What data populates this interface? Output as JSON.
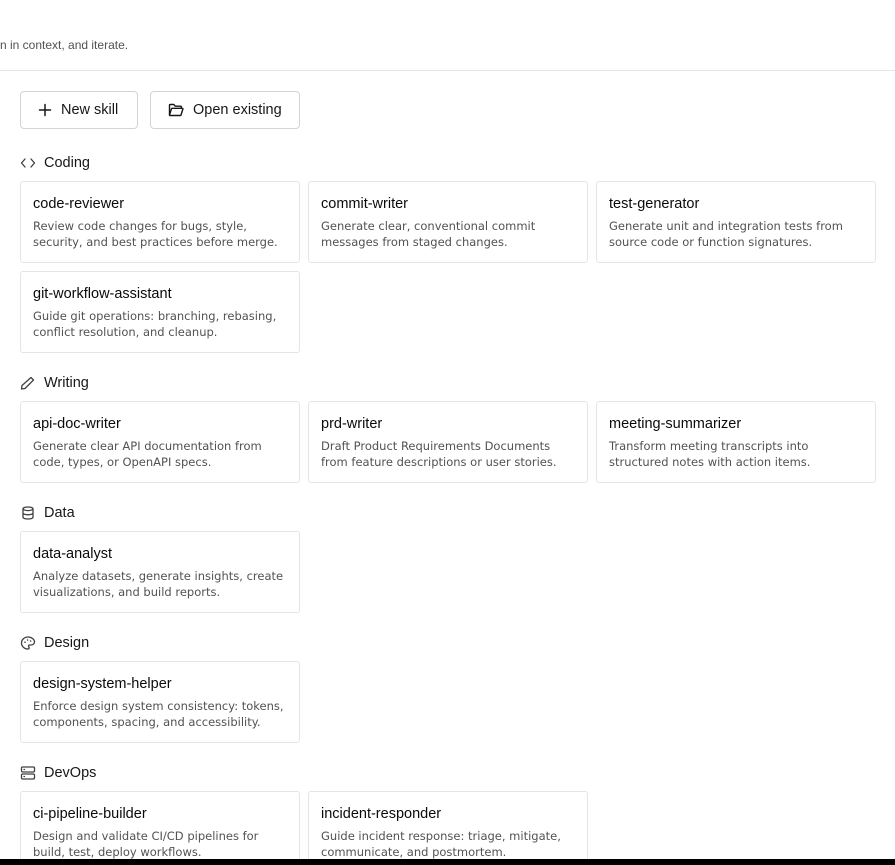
{
  "header": {
    "subtitle_fragment": "n in context, and iterate."
  },
  "actions": {
    "new_skill": "New skill",
    "open_existing": "Open existing"
  },
  "sections": {
    "coding": {
      "label": "Coding",
      "icon": "code-icon",
      "cards": [
        {
          "title": "code-reviewer",
          "desc": "Review code changes for bugs, style, security, and best practices before merge."
        },
        {
          "title": "commit-writer",
          "desc": "Generate clear, conventional commit messages from staged changes."
        },
        {
          "title": "test-generator",
          "desc": "Generate unit and integration tests from source code or function signatures."
        },
        {
          "title": "git-workflow-assistant",
          "desc": "Guide git operations: branching, rebasing, conflict resolution, and cleanup."
        }
      ]
    },
    "writing": {
      "label": "Writing",
      "icon": "pencil-icon",
      "cards": [
        {
          "title": "api-doc-writer",
          "desc": "Generate clear API documentation from code, types, or OpenAPI specs."
        },
        {
          "title": "prd-writer",
          "desc": "Draft Product Requirements Documents from feature descriptions or user stories."
        },
        {
          "title": "meeting-summarizer",
          "desc": "Transform meeting transcripts into structured notes with action items."
        }
      ]
    },
    "data": {
      "label": "Data",
      "icon": "database-icon",
      "cards": [
        {
          "title": "data-analyst",
          "desc": "Analyze datasets, generate insights, create visualizations, and build reports."
        }
      ]
    },
    "design": {
      "label": "Design",
      "icon": "palette-icon",
      "cards": [
        {
          "title": "design-system-helper",
          "desc": "Enforce design system consistency: tokens, components, spacing, and accessibility."
        }
      ]
    },
    "devops": {
      "label": "DevOps",
      "icon": "server-icon",
      "cards": [
        {
          "title": "ci-pipeline-builder",
          "desc": "Design and validate CI/CD pipelines for build, test, deploy workflows."
        },
        {
          "title": "incident-responder",
          "desc": "Guide incident response: triage, mitigate, communicate, and postmortem."
        }
      ]
    }
  }
}
